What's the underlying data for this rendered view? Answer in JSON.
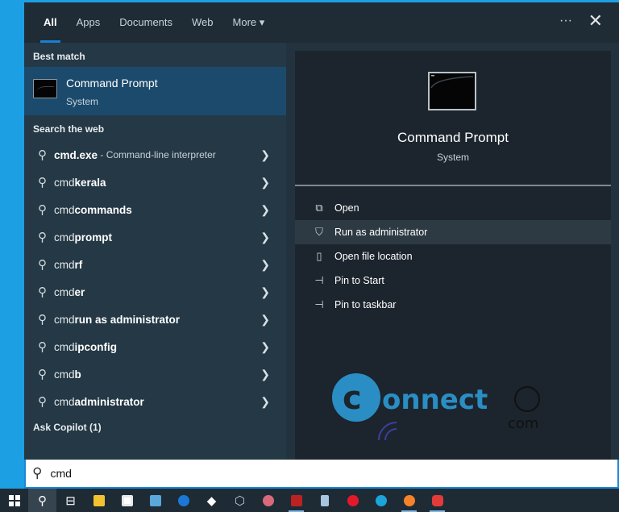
{
  "tabs": [
    {
      "label": "All"
    },
    {
      "label": "Apps"
    },
    {
      "label": "Documents"
    },
    {
      "label": "Web"
    },
    {
      "label": "More ▾"
    }
  ],
  "window": {
    "more_options": "···",
    "close": "✕"
  },
  "left": {
    "best_match_header": "Best match",
    "best_match": {
      "title": "Command Prompt",
      "subtitle": "System"
    },
    "web_header": "Search the web",
    "web_items": [
      {
        "prefix": "cmd.exe",
        "bold": "",
        "desc": " - Command-line interpreter"
      },
      {
        "prefix": "cmd ",
        "bold": "kerala",
        "desc": ""
      },
      {
        "prefix": "cmd ",
        "bold": "commands",
        "desc": ""
      },
      {
        "prefix": "cmd ",
        "bold": "prompt",
        "desc": ""
      },
      {
        "prefix": "cmd",
        "bold": "rf",
        "desc": ""
      },
      {
        "prefix": "cmd",
        "bold": "er",
        "desc": ""
      },
      {
        "prefix": "cmd ",
        "bold": "run as administrator",
        "desc": ""
      },
      {
        "prefix": "cmd ",
        "bold": "ipconfig",
        "desc": ""
      },
      {
        "prefix": "cmd",
        "bold": "b",
        "desc": ""
      },
      {
        "prefix": "cmd ",
        "bold": "administrator",
        "desc": ""
      }
    ],
    "copilot_header": "Ask Copilot (1)"
  },
  "right": {
    "title": "Command Prompt",
    "subtitle": "System",
    "actions": [
      {
        "label": "Open",
        "icon": "open-icon"
      },
      {
        "label": "Run as administrator",
        "icon": "shield-icon"
      },
      {
        "label": "Open file location",
        "icon": "folder-icon"
      },
      {
        "label": "Pin to Start",
        "icon": "pin-icon"
      },
      {
        "label": "Pin to taskbar",
        "icon": "pin-icon"
      }
    ],
    "watermark": "Connect.com"
  },
  "search": {
    "value": "cmd"
  },
  "colors": {
    "accent": "#1a7fd0",
    "desktop": "#1d9fe4"
  }
}
